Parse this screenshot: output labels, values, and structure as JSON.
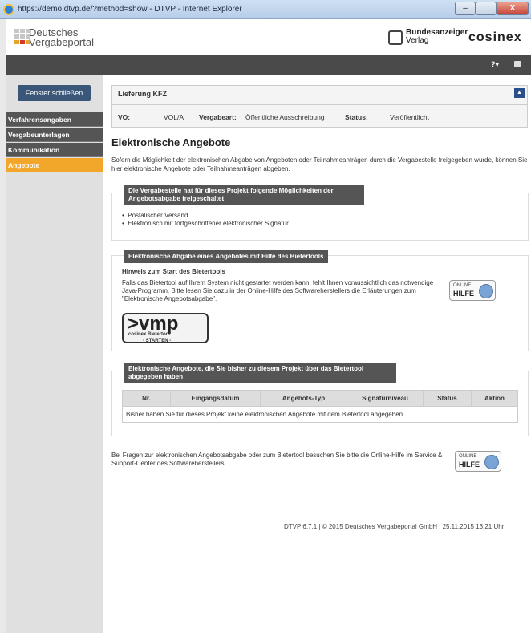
{
  "window": {
    "title": "https://demo.dtvp.de/?method=show - DTVP - Internet Explorer",
    "min": "–",
    "max": "□",
    "close": "X"
  },
  "header": {
    "brand_line1": "Deutsches",
    "brand_line2": "Vergabeportal",
    "partner_line1": "Bundesanzeiger",
    "partner_line2": "Verlag",
    "partner2": "cosinex"
  },
  "topbar": {
    "help_label": "?▾"
  },
  "sidebar": {
    "close_button": "Fenster schließen",
    "items": [
      {
        "label": "Verfahrensangaben"
      },
      {
        "label": "Vergabeunterlagen"
      },
      {
        "label": "Kommunikation"
      },
      {
        "label": "Angebote"
      }
    ]
  },
  "info": {
    "title": "Lieferung KFZ",
    "vo_label": "VO:",
    "vo_value": "VOL/A",
    "art_label": "Vergabeart:",
    "art_value": "Öffentliche Ausschreibung",
    "status_label": "Status:",
    "status_value": "Veröffentlicht"
  },
  "main": {
    "heading": "Elektronische Angebote",
    "intro": "Sofern die Möglichkeit der elektronischen Abgabe von Angeboten oder Teilnahmeanträgen durch die Vergabestelle freigegeben wurde, können Sie hier elektronische Angebote oder Teilnahmeanträgen abgeben.",
    "sec1_title": "Die Vergabestelle hat für dieses Projekt folgende Möglichkeiten der Angebotsabgabe freigeschaltet",
    "options": [
      "Postalischer Versand",
      "Elektronisch mit fortgeschrittener elektronischer Signatur"
    ],
    "sec2_title": "Elektronische Abgabe eines Angebotes mit Hilfe des Bietertools",
    "hint_title": "Hinweis zum Start des Bietertools",
    "hint": "Falls das Bietertool auf Ihrem System nicht gestartet werden kann, fehlt Ihnen voraussichtlich das notwendige Java-Programm. Bitte lesen Sie dazu in der Online-Hilfe des Softwareherstellers die Erläuterungen zum \"Elektronische Angebotsabgabe\".",
    "online": "ONLINE",
    "hilfe": "HILFE",
    "vmp_logo": ">vmp",
    "vmp_sub": "cosinex Bietertool",
    "vmp_start": "- STARTEN -",
    "sec3_title": "Elektronische Angebote, die Sie bisher zu diesem Projekt über das Bietertool abgegeben haben",
    "columns": [
      "Nr.",
      "Eingangsdatum",
      "Angebots-Typ",
      "Signaturniveau",
      "Status",
      "Aktion"
    ],
    "empty_row": "Bisher haben Sie für dieses Projekt keine elektronischen Angebote mit dem Bietertool abgegeben.",
    "bottom_text": "Bei Fragen zur elektronischen Angebotsabgabe oder zum Bietertool besuchen Sie bitte die Online-Hilfe im Service & Support-Center des Softwareherstellers."
  },
  "footer": {
    "text": "DTVP 6.7.1 | © 2015 Deutsches Vergabeportal GmbH | 25.11.2015 13:21 Uhr"
  },
  "colors": {
    "accent": "#f2a62a",
    "nav": "#555555",
    "button": "#3a5678"
  }
}
